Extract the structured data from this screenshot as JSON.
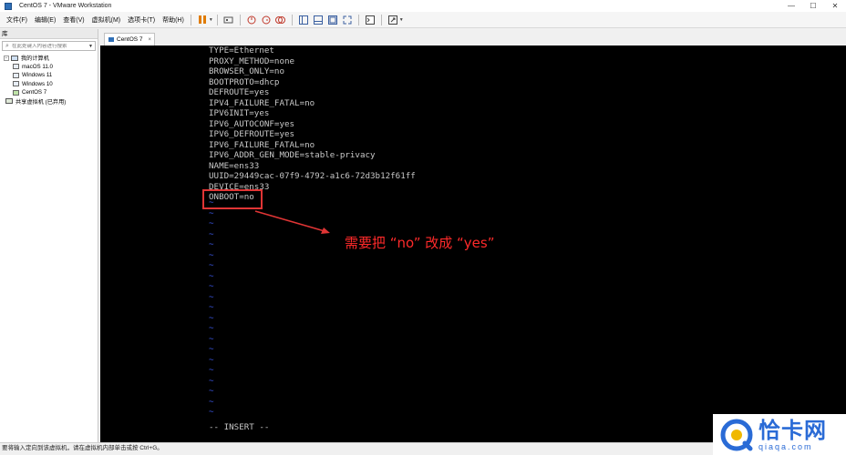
{
  "window": {
    "title": "CentOS 7 - VMware Workstation",
    "controls": {
      "minimize": "—",
      "maximize": "☐",
      "close": "✕"
    }
  },
  "menu": {
    "items": [
      "文件(F)",
      "编辑(E)",
      "查看(V)",
      "虚拟机(M)",
      "选项卡(T)",
      "帮助(H)"
    ]
  },
  "toolbar": {
    "icons": [
      "pause-icon",
      "send-ctrl-alt-del-icon",
      "snapshot-icon",
      "revert-snapshot-icon",
      "snapshot-manager-icon",
      "library-view-icon",
      "thumbnail-view-icon",
      "console-view-icon",
      "fullscreen-icon",
      "unity-icon",
      "console-icon",
      "stretch-icon"
    ]
  },
  "library": {
    "header": "库",
    "search_placeholder": "在此处键入内容进行搜索",
    "root_label": "我的计算机",
    "vms": [
      "macOS 11.0",
      "Windows 11",
      "Windows 10",
      "CentOS 7"
    ],
    "shared_label": "共享虚拟机 (已弃用)"
  },
  "tab": {
    "label": "CentOS 7",
    "close": "×"
  },
  "terminal": {
    "lines": [
      "TYPE=Ethernet",
      "PROXY_METHOD=none",
      "BROWSER_ONLY=no",
      "BOOTPROTO=dhcp",
      "DEFROUTE=yes",
      "IPV4_FAILURE_FATAL=no",
      "IPV6INIT=yes",
      "IPV6_AUTOCONF=yes",
      "IPV6_DEFROUTE=yes",
      "IPV6_FAILURE_FATAL=no",
      "IPV6_ADDR_GEN_MODE=stable-privacy",
      "NAME=ens33",
      "UUID=29449cac-07f9-4792-a1c6-72d3b12f61ff",
      "DEVICE=ens33",
      "ONBOOT=no"
    ],
    "tilde_count": 21,
    "mode_line": "-- INSERT --"
  },
  "annotation": {
    "text": "需要把 “no” 改成 “yes”",
    "color": "#ff2a2a"
  },
  "status": {
    "text": "要将输入定向到该虚拟机，请在虚拟机内部单击或按 Ctrl+G。"
  },
  "watermark": {
    "name": "恰卡网",
    "url": "qiaqa.com"
  }
}
